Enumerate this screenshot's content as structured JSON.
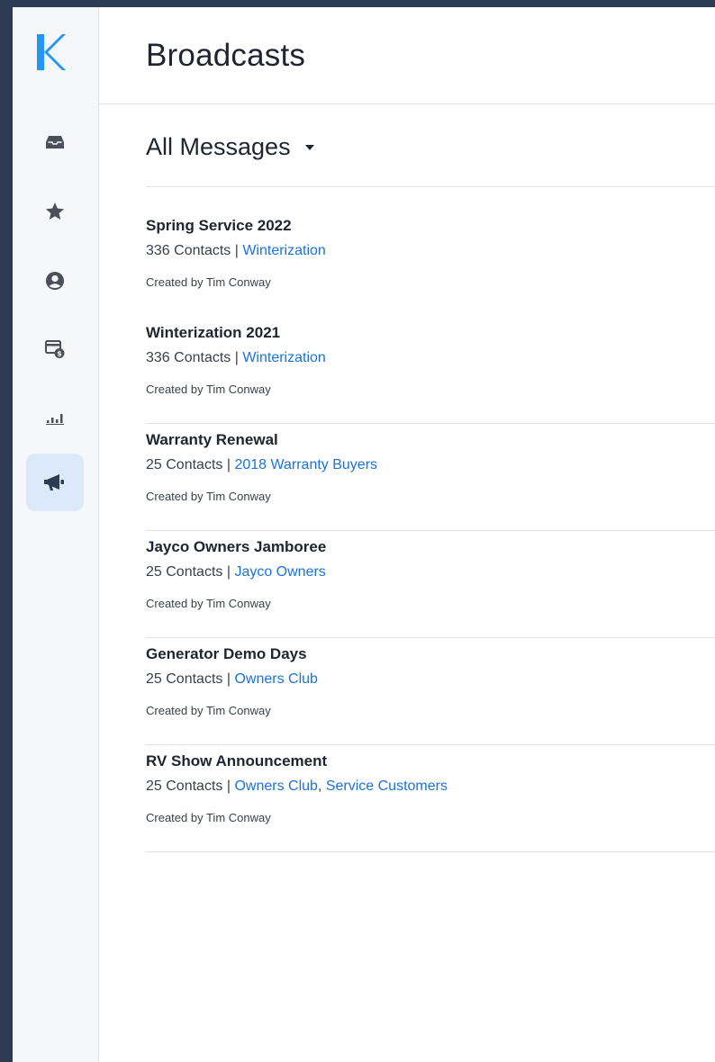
{
  "app": {
    "logo_letter": "K"
  },
  "nav": {
    "items": [
      {
        "icon": "inbox-icon"
      },
      {
        "icon": "star-icon"
      },
      {
        "icon": "contact-icon"
      },
      {
        "icon": "billing-icon"
      },
      {
        "icon": "reports-icon"
      },
      {
        "icon": "megaphone-icon",
        "active": true
      }
    ]
  },
  "header": {
    "title": "Broadcasts"
  },
  "filter": {
    "label": "All Messages"
  },
  "broadcasts": [
    {
      "title": "Spring Service 2022",
      "contacts": "336 Contacts",
      "separator": " | ",
      "lists": [
        "Winterization"
      ],
      "created": "Created by Tim Conway"
    },
    {
      "title": "Winterization 2021",
      "contacts": "336 Contacts",
      "separator": " | ",
      "lists": [
        "Winterization"
      ],
      "created": "Created by Tim Conway"
    },
    {
      "title": "Warranty Renewal",
      "contacts": "25 Contacts",
      "separator": " | ",
      "lists": [
        "2018 Warranty Buyers"
      ],
      "created": "Created by Tim Conway"
    },
    {
      "title": "Jayco Owners Jamboree",
      "contacts": "25 Contacts",
      "separator": " | ",
      "lists": [
        "Jayco Owners"
      ],
      "created": "Created by Tim Conway"
    },
    {
      "title": "Generator Demo Days",
      "contacts": "25 Contacts",
      "separator": " | ",
      "lists": [
        "Owners Club"
      ],
      "created": "Created by Tim Conway"
    },
    {
      "title": "RV Show Announcement",
      "contacts": "25 Contacts",
      "separator": " | ",
      "lists": [
        "Owners Club",
        "Service Customers"
      ],
      "list_joiner": ", ",
      "created": "Created by Tim Conway"
    }
  ],
  "colors": {
    "outer_background": "#2c3a52",
    "accent": "#1a73d9",
    "active_nav_background": "#dce9fb"
  }
}
